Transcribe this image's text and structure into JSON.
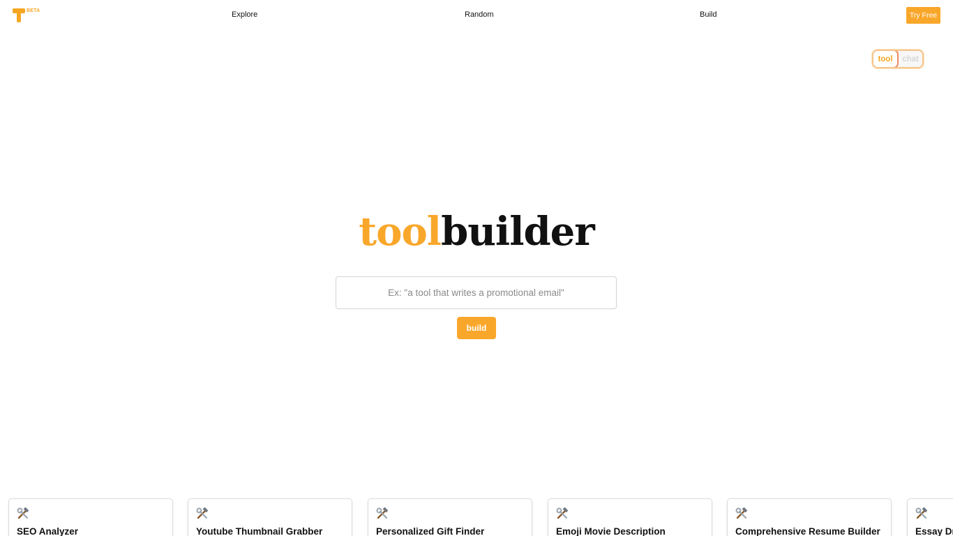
{
  "header": {
    "beta_label": "BETA",
    "nav": [
      {
        "label": "Explore"
      },
      {
        "label": "Random"
      },
      {
        "label": "Build"
      }
    ],
    "try_free_label": "Try Free"
  },
  "mode_toggle": {
    "tool_label": "tool",
    "chat_label": "chat",
    "selected": "tool"
  },
  "hero": {
    "title_part1": "tool",
    "title_part2": "builder",
    "search_placeholder": "Ex: \"a tool that writes a promotional email\"",
    "build_label": "build"
  },
  "cards": [
    {
      "icon": "hammer-and-wrench-icon",
      "title": "SEO Analyzer"
    },
    {
      "icon": "hammer-and-wrench-icon",
      "title": "Youtube Thumbnail Grabber"
    },
    {
      "icon": "hammer-and-wrench-icon",
      "title": "Personalized Gift Finder"
    },
    {
      "icon": "hammer-and-wrench-icon",
      "title": "Emoji Movie Description"
    },
    {
      "icon": "hammer-and-wrench-icon",
      "title": "Comprehensive Resume Builder"
    },
    {
      "icon": "hammer-and-wrench-icon",
      "title": "Essay Dr"
    }
  ],
  "colors": {
    "accent": "#f9a72b",
    "text": "#111111"
  }
}
